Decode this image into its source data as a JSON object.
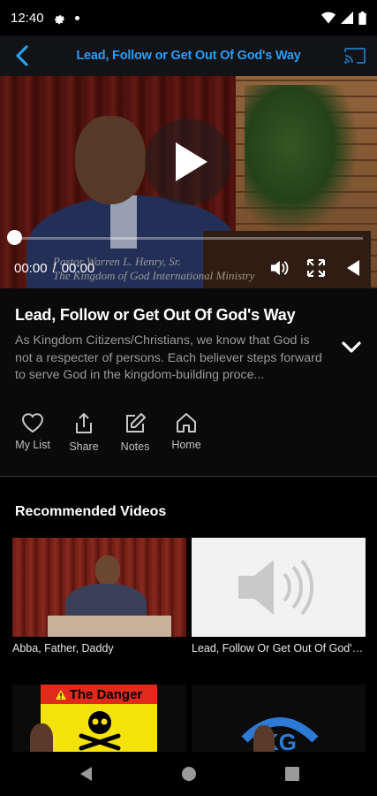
{
  "status_bar": {
    "time": "12:40"
  },
  "app_bar": {
    "title": "Lead, Follow or Get Out Of God's Way",
    "accent": "#2a9df4"
  },
  "player": {
    "current_time": "00:00",
    "separator": "/",
    "duration": "00:00",
    "progress": 0,
    "overlay_line1": "Pastor Warren L. Henry, Sr.",
    "overlay_line2": "The Kingdom of God International Ministry"
  },
  "video": {
    "title": "Lead, Follow or Get Out Of God's Way",
    "description": "As Kingdom Citizens/Christians, we know that God is not a respecter of persons. Each believer steps forward to serve God in the kingdom-building proce..."
  },
  "actions": [
    {
      "label": "My List",
      "icon": "heart-icon"
    },
    {
      "label": "Share",
      "icon": "share-icon"
    },
    {
      "label": "Notes",
      "icon": "edit-icon"
    },
    {
      "label": "Home",
      "icon": "home-icon"
    }
  ],
  "recommended": {
    "heading": "Recommended Videos",
    "items": [
      {
        "caption": "Abba, Father, Daddy"
      },
      {
        "caption": "Lead, Follow Or Get Out Of God's Way"
      },
      {
        "caption": "",
        "thumb_text": "The Danger"
      },
      {
        "caption": ""
      }
    ]
  }
}
